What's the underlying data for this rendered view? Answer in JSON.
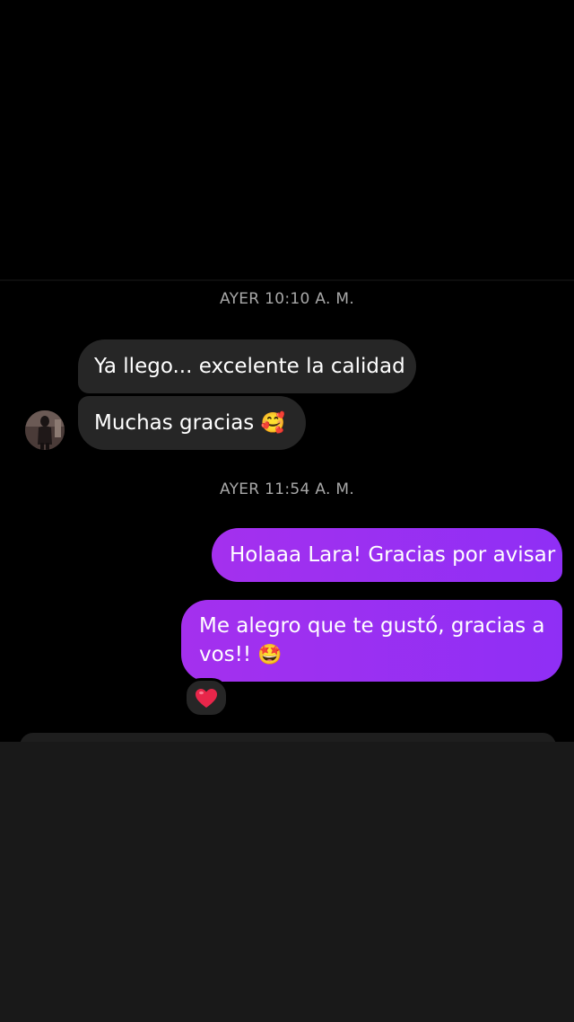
{
  "conversation": {
    "groups": [
      {
        "timestamp": "AYER 10:10 A. M.",
        "messages": [
          {
            "sender": "them",
            "text": "Ya llego... excelente la calidad"
          },
          {
            "sender": "them",
            "text": "Muchas gracias",
            "emoji": "🥰"
          }
        ]
      },
      {
        "timestamp": "AYER 11:54 A. M.",
        "messages": [
          {
            "sender": "me",
            "text": "Holaaa Lara! Gracias por avisar"
          },
          {
            "sender": "me",
            "text_line1": "Me alegro que te gustó, gracias a",
            "text_line2": "vos!!",
            "emoji": "🤩",
            "reaction": "❤️"
          }
        ]
      }
    ]
  },
  "colors": {
    "background": "#000000",
    "incoming_bubble": "#262626",
    "outgoing_bubble": "#9a2cf0",
    "timestamp_text": "#a8a8a8",
    "bottom_panel": "#191919"
  },
  "icons": {
    "avatar": "contact-avatar-photo",
    "reaction": "red-heart-emoji"
  }
}
